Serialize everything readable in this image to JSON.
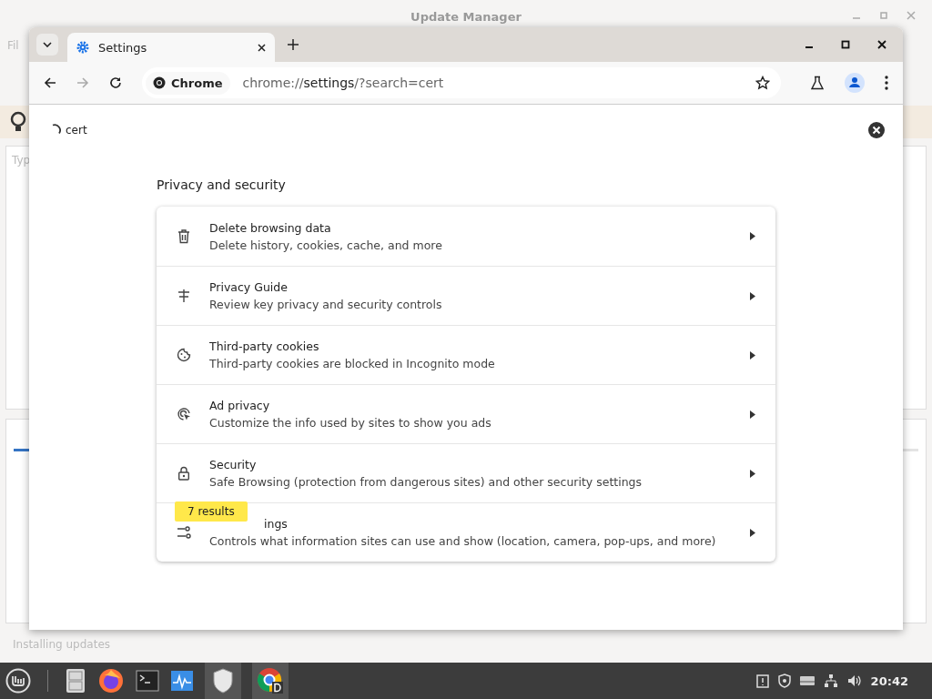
{
  "background_window": {
    "title": "Update Manager",
    "menu_fragment": "Fil",
    "field_fragment": "Typ",
    "status": "Installing updates",
    "progress": {
      "level": 0.017
    }
  },
  "browser": {
    "tab": {
      "label": "Settings",
      "selected": true
    },
    "omnibox": {
      "chip": "Chrome",
      "url_host": "chrome://",
      "url_path": "settings",
      "url_query": "/?search=cert"
    },
    "search": {
      "value": "cert"
    },
    "section_title": "Privacy and security",
    "rows": [
      {
        "kind": "trash",
        "title": "Delete browsing data",
        "subtitle": "Delete history, cookies, cache, and more"
      },
      {
        "kind": "guide",
        "title": "Privacy Guide",
        "subtitle": "Review key privacy and security controls"
      },
      {
        "kind": "cookie",
        "title": "Third-party cookies",
        "subtitle": "Third-party cookies are blocked in Incognito mode"
      },
      {
        "kind": "ad",
        "title": "Ad privacy",
        "subtitle": "Customize the info used by sites to show you ads"
      },
      {
        "kind": "lock",
        "title": "Security",
        "subtitle": "Safe Browsing (protection from dangerous sites) and other security settings"
      },
      {
        "kind": "sliders",
        "title": "ings",
        "subtitle": "Controls what information sites can use and show (location, camera, pop-ups, and more)"
      }
    ],
    "results_bubble": "7 results"
  },
  "taskbar": {
    "clock": "20:42"
  }
}
